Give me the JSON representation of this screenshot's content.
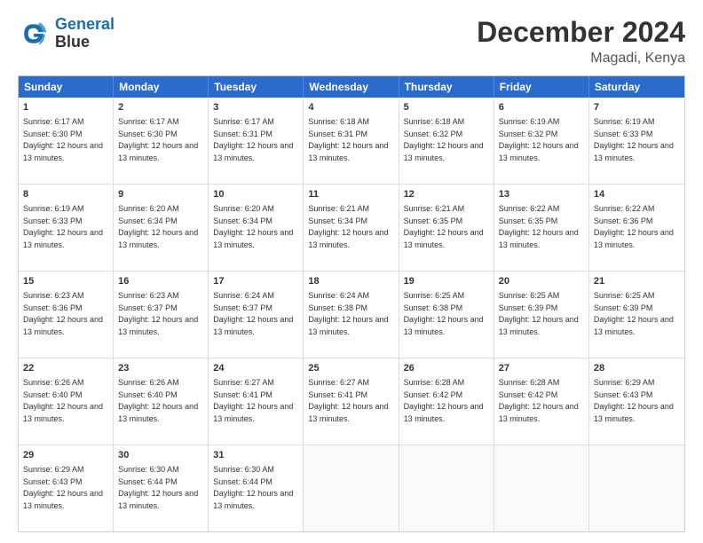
{
  "logo": {
    "line1": "General",
    "line2": "Blue"
  },
  "title": "December 2024",
  "location": "Magadi, Kenya",
  "days": [
    "Sunday",
    "Monday",
    "Tuesday",
    "Wednesday",
    "Thursday",
    "Friday",
    "Saturday"
  ],
  "rows": [
    [
      {
        "num": "1",
        "rise": "6:17 AM",
        "set": "6:30 PM",
        "daylight": "12 hours and 13 minutes."
      },
      {
        "num": "2",
        "rise": "6:17 AM",
        "set": "6:30 PM",
        "daylight": "12 hours and 13 minutes."
      },
      {
        "num": "3",
        "rise": "6:17 AM",
        "set": "6:31 PM",
        "daylight": "12 hours and 13 minutes."
      },
      {
        "num": "4",
        "rise": "6:18 AM",
        "set": "6:31 PM",
        "daylight": "12 hours and 13 minutes."
      },
      {
        "num": "5",
        "rise": "6:18 AM",
        "set": "6:32 PM",
        "daylight": "12 hours and 13 minutes."
      },
      {
        "num": "6",
        "rise": "6:19 AM",
        "set": "6:32 PM",
        "daylight": "12 hours and 13 minutes."
      },
      {
        "num": "7",
        "rise": "6:19 AM",
        "set": "6:33 PM",
        "daylight": "12 hours and 13 minutes."
      }
    ],
    [
      {
        "num": "8",
        "rise": "6:19 AM",
        "set": "6:33 PM",
        "daylight": "12 hours and 13 minutes."
      },
      {
        "num": "9",
        "rise": "6:20 AM",
        "set": "6:34 PM",
        "daylight": "12 hours and 13 minutes."
      },
      {
        "num": "10",
        "rise": "6:20 AM",
        "set": "6:34 PM",
        "daylight": "12 hours and 13 minutes."
      },
      {
        "num": "11",
        "rise": "6:21 AM",
        "set": "6:34 PM",
        "daylight": "12 hours and 13 minutes."
      },
      {
        "num": "12",
        "rise": "6:21 AM",
        "set": "6:35 PM",
        "daylight": "12 hours and 13 minutes."
      },
      {
        "num": "13",
        "rise": "6:22 AM",
        "set": "6:35 PM",
        "daylight": "12 hours and 13 minutes."
      },
      {
        "num": "14",
        "rise": "6:22 AM",
        "set": "6:36 PM",
        "daylight": "12 hours and 13 minutes."
      }
    ],
    [
      {
        "num": "15",
        "rise": "6:23 AM",
        "set": "6:36 PM",
        "daylight": "12 hours and 13 minutes."
      },
      {
        "num": "16",
        "rise": "6:23 AM",
        "set": "6:37 PM",
        "daylight": "12 hours and 13 minutes."
      },
      {
        "num": "17",
        "rise": "6:24 AM",
        "set": "6:37 PM",
        "daylight": "12 hours and 13 minutes."
      },
      {
        "num": "18",
        "rise": "6:24 AM",
        "set": "6:38 PM",
        "daylight": "12 hours and 13 minutes."
      },
      {
        "num": "19",
        "rise": "6:25 AM",
        "set": "6:38 PM",
        "daylight": "12 hours and 13 minutes."
      },
      {
        "num": "20",
        "rise": "6:25 AM",
        "set": "6:39 PM",
        "daylight": "12 hours and 13 minutes."
      },
      {
        "num": "21",
        "rise": "6:25 AM",
        "set": "6:39 PM",
        "daylight": "12 hours and 13 minutes."
      }
    ],
    [
      {
        "num": "22",
        "rise": "6:26 AM",
        "set": "6:40 PM",
        "daylight": "12 hours and 13 minutes."
      },
      {
        "num": "23",
        "rise": "6:26 AM",
        "set": "6:40 PM",
        "daylight": "12 hours and 13 minutes."
      },
      {
        "num": "24",
        "rise": "6:27 AM",
        "set": "6:41 PM",
        "daylight": "12 hours and 13 minutes."
      },
      {
        "num": "25",
        "rise": "6:27 AM",
        "set": "6:41 PM",
        "daylight": "12 hours and 13 minutes."
      },
      {
        "num": "26",
        "rise": "6:28 AM",
        "set": "6:42 PM",
        "daylight": "12 hours and 13 minutes."
      },
      {
        "num": "27",
        "rise": "6:28 AM",
        "set": "6:42 PM",
        "daylight": "12 hours and 13 minutes."
      },
      {
        "num": "28",
        "rise": "6:29 AM",
        "set": "6:43 PM",
        "daylight": "12 hours and 13 minutes."
      }
    ],
    [
      {
        "num": "29",
        "rise": "6:29 AM",
        "set": "6:43 PM",
        "daylight": "12 hours and 13 minutes."
      },
      {
        "num": "30",
        "rise": "6:30 AM",
        "set": "6:44 PM",
        "daylight": "12 hours and 13 minutes."
      },
      {
        "num": "31",
        "rise": "6:30 AM",
        "set": "6:44 PM",
        "daylight": "12 hours and 13 minutes."
      },
      null,
      null,
      null,
      null
    ]
  ]
}
